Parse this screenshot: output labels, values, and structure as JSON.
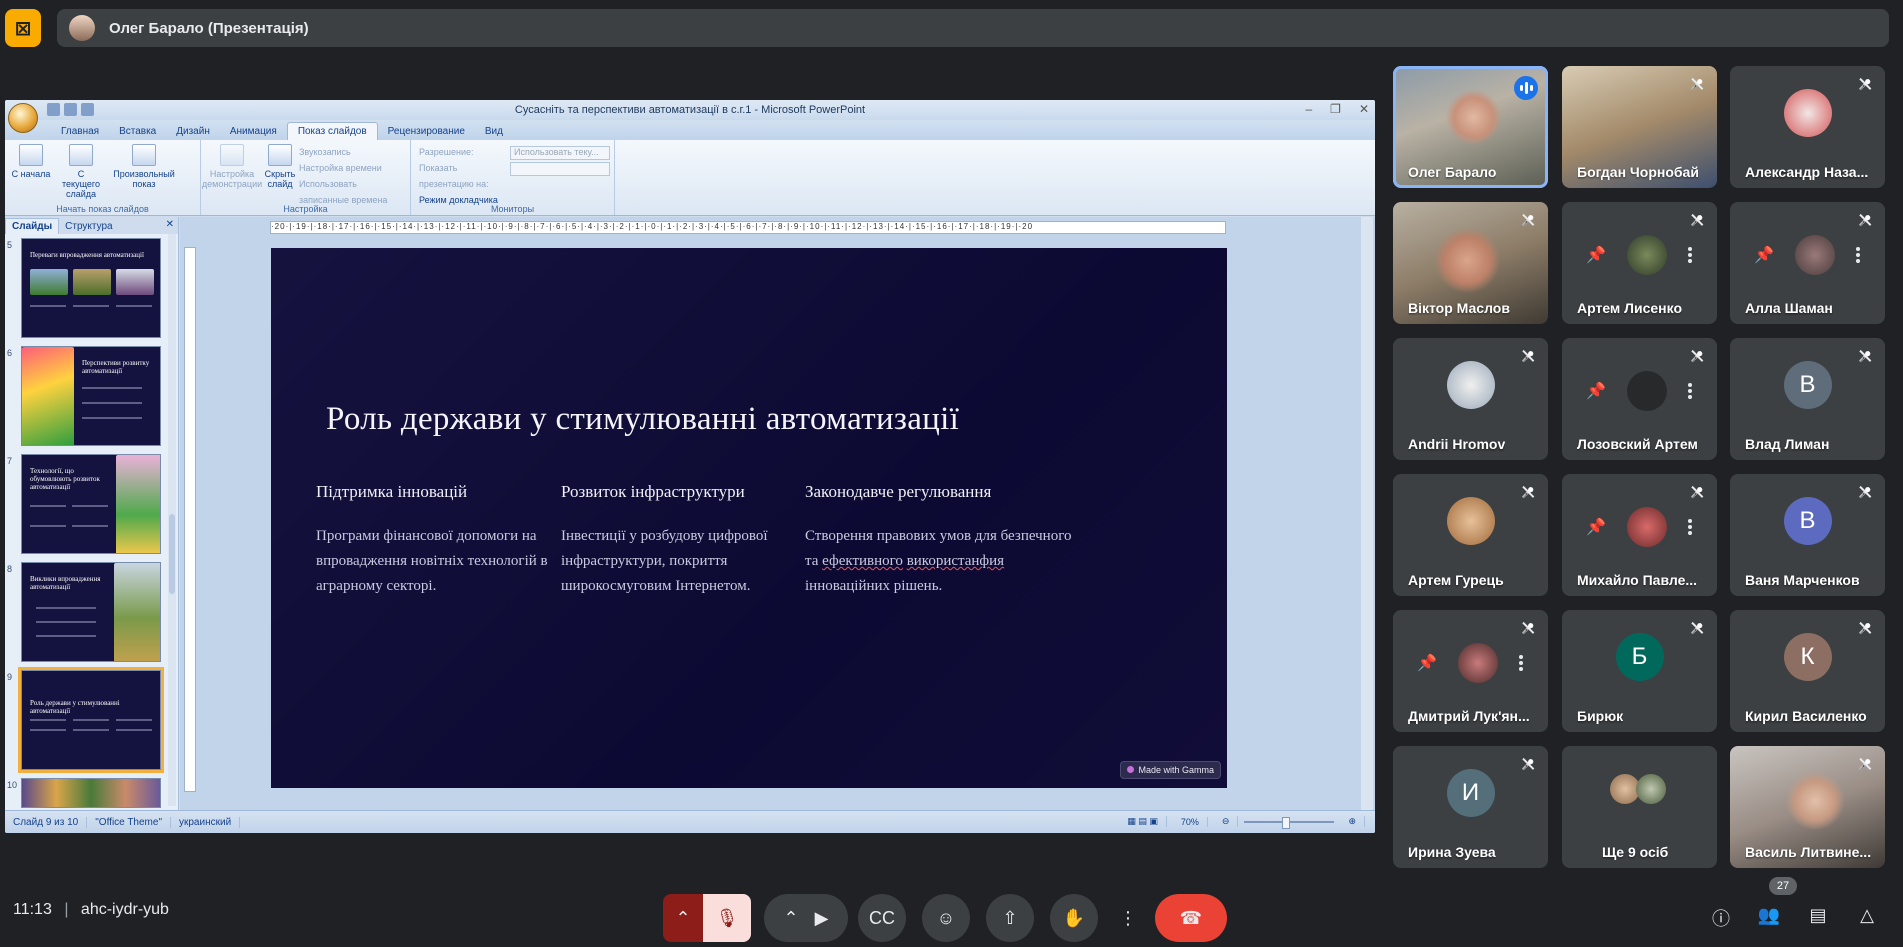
{
  "meet": {
    "presenter_label": "Олег Барало (Презентація)",
    "time": "11:13",
    "meeting_code": "ahc-iydr-yub",
    "participants_count": "27"
  },
  "ppt": {
    "window_title": "Сусасніть та перспективи автоматизації в с.г.1 - Microsoft PowerPoint",
    "tabs": [
      "Главная",
      "Вставка",
      "Дизайн",
      "Анимация",
      "Показ слайдов",
      "Рецензирование",
      "Вид"
    ],
    "ribbon": {
      "btn_start": "С начала",
      "btn_current": "С текущего слайда",
      "btn_custom": "Произвольный показ",
      "group_start": "Начать показ слайдов",
      "btn_setup": "Настройка демонстрации",
      "btn_hide": "Скрыть слайд",
      "opt_record": "Звукозапись",
      "opt_timing": "Настройка времени",
      "opt_use_timing": "Использовать записанные времена",
      "group_setup": "Настройка",
      "opt_resolution": "Разрешение:",
      "opt_resolution_val": "Использовать теку...",
      "opt_show_on": "Показать презентацию на:",
      "opt_presenter": "Режим докладчика",
      "group_monitors": "Мониторы"
    },
    "pane_tabs": [
      "Слайды",
      "Структура"
    ],
    "thumbs": [
      {
        "num": "5",
        "title": "Переваги впровадження автоматизації"
      },
      {
        "num": "6",
        "title": "Перспективи розвитку автоматизації"
      },
      {
        "num": "7",
        "title": "Технології, що обумовлюють розвиток автоматизації"
      },
      {
        "num": "8",
        "title": "Виклики впровадження автоматизації"
      },
      {
        "num": "9",
        "title": "Роль держави у стимулюванні автоматизації"
      },
      {
        "num": "10",
        "title": ""
      }
    ],
    "slide": {
      "title": "Роль держави у стимулюванні автоматизації",
      "columns": [
        {
          "heading": "Підтримка інновацій",
          "text": "Програми фінансової допомоги на впровадження новітніх технологій в аграрному секторі."
        },
        {
          "heading": "Розвиток інфраструктури",
          "text": "Інвестиції у розбудову цифрової інфраструктури, покриття широкосмуговим Інтернетом."
        },
        {
          "heading": "Законодавче регулювання",
          "text_before": "Створення правових умов для безпечного та ",
          "text_u1": "ефективного",
          "text_mid": " ",
          "text_u2": "використанфия",
          "text_after": " інноваційних рішень."
        }
      ],
      "badge": "Made with Gamma"
    },
    "status": {
      "slide_of": "Слайд 9 из 10",
      "theme": "\"Office Theme\"",
      "lang": "украинский",
      "zoom": "70%"
    }
  },
  "participants": [
    {
      "name": "Олег Барало",
      "speaking": true
    },
    {
      "name": "Богдан Чорнобай"
    },
    {
      "name": "Александр Наза..."
    },
    {
      "name": "Віктор Маслов"
    },
    {
      "name": "Артем Лисенко"
    },
    {
      "name": "Алла Шаман"
    },
    {
      "name": "Andrii Hromov"
    },
    {
      "name": "Лозовский Артем"
    },
    {
      "name": "Влад Лиман",
      "letter": "В"
    },
    {
      "name": "Артем Гурець"
    },
    {
      "name": "Михайло Павле..."
    },
    {
      "name": "Ваня Марченков",
      "letter": "В"
    },
    {
      "name": "Дмитрий Лук'ян..."
    },
    {
      "name": "Бирюк",
      "letter": "Б"
    },
    {
      "name": "Кирил Василенко",
      "letter": "К"
    },
    {
      "name": "Ирина Зуева",
      "letter": "И"
    },
    {
      "name": "Ще 9 осіб"
    },
    {
      "name": "Василь Литвине..."
    }
  ],
  "colors": {
    "bg": "#202124",
    "tile": "#3c4043",
    "accent_blue": "#8ab4f8",
    "end_call": "#ea4335",
    "presenting_badge": "#f9ab00",
    "slide_bg": "#110e3a"
  },
  "icons": [
    "presentation-off-icon",
    "mic-off-icon",
    "camera-icon",
    "captions-icon",
    "emoji-icon",
    "present-icon",
    "raise-hand-icon",
    "more-icon",
    "end-call-icon",
    "info-icon",
    "people-icon",
    "chat-icon",
    "activities-icon",
    "pin-icon"
  ]
}
